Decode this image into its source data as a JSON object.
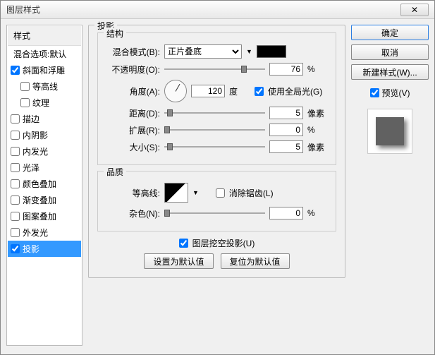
{
  "title": "图层样式",
  "left": {
    "header": "样式",
    "blend": "混合选项:默认",
    "items": [
      {
        "label": "斜面和浮雕",
        "checked": true,
        "indent": false
      },
      {
        "label": "等高线",
        "checked": false,
        "indent": true
      },
      {
        "label": "纹理",
        "checked": false,
        "indent": true
      },
      {
        "label": "描边",
        "checked": false,
        "indent": false
      },
      {
        "label": "内阴影",
        "checked": false,
        "indent": false
      },
      {
        "label": "内发光",
        "checked": false,
        "indent": false
      },
      {
        "label": "光泽",
        "checked": false,
        "indent": false
      },
      {
        "label": "颜色叠加",
        "checked": false,
        "indent": false
      },
      {
        "label": "渐变叠加",
        "checked": false,
        "indent": false
      },
      {
        "label": "图案叠加",
        "checked": false,
        "indent": false
      },
      {
        "label": "外发光",
        "checked": false,
        "indent": false
      },
      {
        "label": "投影",
        "checked": true,
        "indent": false,
        "selected": true
      }
    ]
  },
  "mid": {
    "section_title": "投影",
    "structure_title": "结构",
    "blendmode_label": "混合模式(B):",
    "blendmode_value": "正片叠底",
    "opacity_label": "不透明度(O):",
    "opacity_value": "76",
    "percent": "%",
    "angle_label": "角度(A):",
    "angle_value": "120",
    "degree": "度",
    "global_light": "使用全局光(G)",
    "distance_label": "距离(D):",
    "distance_value": "5",
    "px": "像素",
    "spread_label": "扩展(R):",
    "spread_value": "0",
    "size_label": "大小(S):",
    "size_value": "5",
    "quality_title": "品质",
    "contour_label": "等高线:",
    "antialias": "消除锯齿(L)",
    "noise_label": "杂色(N):",
    "noise_value": "0",
    "knockout": "图层挖空投影(U)",
    "set_default": "设置为默认值",
    "reset_default": "复位为默认值"
  },
  "right": {
    "ok": "确定",
    "cancel": "取消",
    "new_style": "新建样式(W)...",
    "preview": "预览(V)"
  }
}
